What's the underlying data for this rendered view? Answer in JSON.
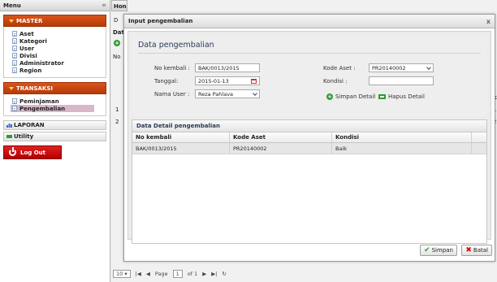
{
  "sidebar": {
    "title": "Menu",
    "collapse_icon": "«",
    "master": {
      "label": "MASTER",
      "items": [
        "Aset",
        "Kategori",
        "User",
        "Divisi",
        "Administrator",
        "Region"
      ]
    },
    "transaksi": {
      "label": "TRANSAKSI",
      "items": [
        "Peminjaman",
        "Pengembalian"
      ],
      "active": "Pengembalian"
    },
    "laporan": "LAPORAN",
    "utility": "Utility",
    "logout": "Log Out"
  },
  "background": {
    "tab": "Hon",
    "row_label_d": "D",
    "row_label_dat": "Dat",
    "col_no": "No",
    "row1": "1",
    "row2": "2",
    "right_k": "k",
    "right_1": "1",
    "right_2": "2"
  },
  "pager": {
    "page_size": "10",
    "page_label": "Page",
    "page_value": "1",
    "of_label": "of 1"
  },
  "dialog": {
    "title": "Input pengembalian",
    "close": "x",
    "form": {
      "heading": "Data pengembalian",
      "no_kembali_label": "No kembali :",
      "no_kembali_value": "BAK/0013/2015",
      "tanggal_label": "Tanggal:",
      "tanggal_value": "2015-01-13",
      "nama_user_label": "Nama User :",
      "nama_user_value": "Reza Pahlava",
      "kode_aset_label": "Kode Aset :",
      "kode_aset_value": "PR20140002",
      "kondisi_label": "Kondisi :",
      "kondisi_value": "",
      "simpan_detail": "Simpan Detail",
      "hapus_detail": "Hapus Detail"
    },
    "grid": {
      "title": "Data Detail pengembalian",
      "columns": [
        "No kembali",
        "Kode Aset",
        "Kondisi"
      ],
      "rows": [
        [
          "BAK/0013/2015",
          "PR20140002",
          "Baik"
        ]
      ]
    },
    "buttons": {
      "save": "Simpan",
      "cancel": "Batal"
    }
  },
  "colors": {
    "section_header": "#c94a0f",
    "logout": "#c00000",
    "active_item": "#d9b7c8",
    "action_green": "#2e9a2e"
  }
}
